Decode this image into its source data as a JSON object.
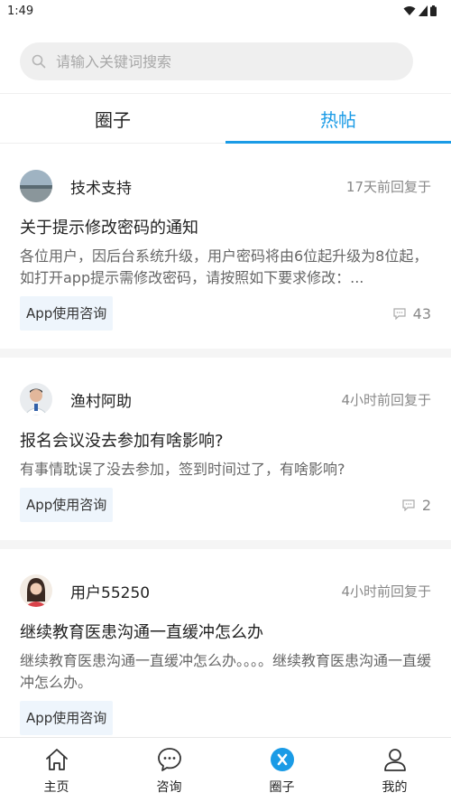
{
  "status_bar": {
    "time": "1:49"
  },
  "search": {
    "placeholder": "请输入关键词搜索"
  },
  "tabs": [
    {
      "label": "圈子",
      "active": false
    },
    {
      "label": "热帖",
      "active": true
    }
  ],
  "posts": [
    {
      "author": "技术支持",
      "time": "17天前回复于",
      "title": "关于提示修改密码的通知",
      "excerpt": "各位用户，因后台系统升级，用户密码将由6位起升级为8位起，如打开app提示需修改密码，请按照如下要求修改：...",
      "tag": "App使用咨询",
      "comments": "43"
    },
    {
      "author": "渔村阿助",
      "time": "4小时前回复于",
      "title": "报名会议没去参加有啥影响?",
      "excerpt": "有事情耽误了没去参加，签到时间过了，有啥影响?",
      "tag": "App使用咨询",
      "comments": "2"
    },
    {
      "author": "用户55250",
      "time": "4小时前回复于",
      "title": "继续教育医患沟通一直缓冲怎么办",
      "excerpt": "继续教育医患沟通一直缓冲怎么办。。。。继续教育医患沟通一直缓冲怎么办。",
      "tag": "App使用咨询",
      "comments": ""
    }
  ],
  "bottom_nav": [
    {
      "label": "主页",
      "icon": "home-icon"
    },
    {
      "label": "咨询",
      "icon": "chat-icon"
    },
    {
      "label": "圈子",
      "icon": "circle-icon"
    },
    {
      "label": "我的",
      "icon": "profile-icon"
    }
  ],
  "colors": {
    "accent": "#1a9be6",
    "tag_bg": "#eef5fc"
  }
}
